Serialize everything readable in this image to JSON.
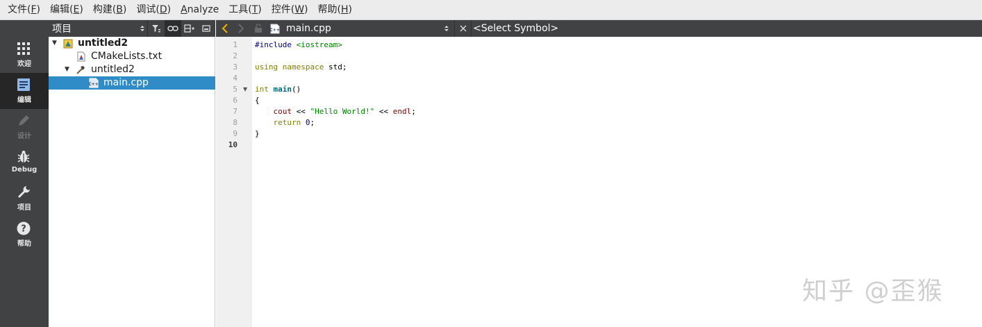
{
  "menu": [
    {
      "label": "文件(",
      "mnemonic": "F",
      "end": ")"
    },
    {
      "label": "编辑(",
      "mnemonic": "E",
      "end": ")"
    },
    {
      "label": "构建(",
      "mnemonic": "B",
      "end": ")"
    },
    {
      "label": "调试(",
      "mnemonic": "D",
      "end": ")"
    },
    {
      "label": "",
      "mnemonic": "A",
      "end": "nalyze"
    },
    {
      "label": "工具(",
      "mnemonic": "T",
      "end": ")"
    },
    {
      "label": "控件(",
      "mnemonic": "W",
      "end": ")"
    },
    {
      "label": "帮助(",
      "mnemonic": "H",
      "end": ")"
    }
  ],
  "modes": [
    {
      "label": "欢迎",
      "icon": "grid-icon"
    },
    {
      "label": "编辑",
      "icon": "document-icon"
    },
    {
      "label": "设计",
      "icon": "pencil-icon"
    },
    {
      "label": "Debug",
      "icon": "bug-icon"
    },
    {
      "label": "项目",
      "icon": "wrench-icon"
    },
    {
      "label": "帮助",
      "icon": "help-icon"
    }
  ],
  "project_panel": {
    "title": "项目",
    "tree": [
      {
        "label": "untitled2",
        "icon": "project-icon"
      },
      {
        "label": "CMakeLists.txt",
        "icon": "cmake-file-icon"
      },
      {
        "label": "untitled2",
        "icon": "build-target-icon"
      },
      {
        "label": "main.cpp",
        "icon": "cpp-file-icon"
      }
    ]
  },
  "editor": {
    "file_name": "main.cpp",
    "symbol": "<Select Symbol>",
    "line_numbers": [
      "1",
      "2",
      "3",
      "4",
      "5",
      "6",
      "7",
      "8",
      "9",
      "10"
    ],
    "code": {
      "l1_pre": "#include ",
      "l1_inc": "<iostream>",
      "l3_kw1": "using",
      "l3_kw2": "namespace",
      "l3_ns": "std;",
      "l5_kw": "int",
      "l5_fn": "main",
      "l5_rest": "()",
      "l6": "{",
      "l7_id": "cout",
      "l7_op1": " << ",
      "l7_str": "\"Hello World!\"",
      "l7_op2": " << ",
      "l7_endl": "endl",
      "l7_end": ";",
      "l8_kw": "return",
      "l8_num": "0",
      "l8_end": ";",
      "l9": "}"
    }
  },
  "watermark": "知乎 @歪猴",
  "colors": {
    "accent": "#308cc6",
    "modebar": "#404244"
  }
}
